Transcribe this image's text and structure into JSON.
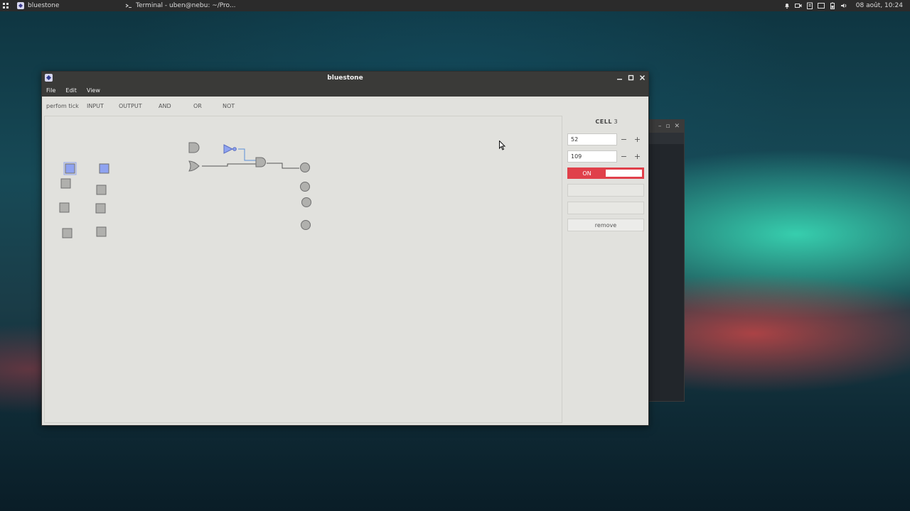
{
  "top_panel": {
    "tasks": [
      {
        "label": "bluestone"
      },
      {
        "label": "Terminal - uben@nebu: ~/Pro..."
      }
    ],
    "clock": "08 août, 10:24"
  },
  "window": {
    "title": "bluestone",
    "menu": [
      "File",
      "Edit",
      "View"
    ],
    "toolbar": [
      "perfom tick",
      "INPUT",
      "OUTPUT",
      "AND",
      "OR",
      "NOT"
    ]
  },
  "side_panel": {
    "cell_label": "CELL",
    "cell_number": "3",
    "x_value": "52",
    "y_value": "109",
    "minus": "−",
    "plus": "+",
    "toggle_on_label": "ON",
    "remove_label": "remove"
  },
  "colors": {
    "accent_red": "#e0404a",
    "selected_blue": "#8fa3f0",
    "node_gray": "#b0b0ad",
    "wire_blue": "#5b8fd6"
  },
  "icons": [
    "apps-grid-icon",
    "bluestone-app-icon",
    "terminal-icon",
    "bell-icon",
    "camera-icon",
    "clipboard-icon",
    "window-icon",
    "battery-icon",
    "volume-icon",
    "minimize-icon",
    "maximize-icon",
    "close-icon",
    "cursor-icon"
  ]
}
